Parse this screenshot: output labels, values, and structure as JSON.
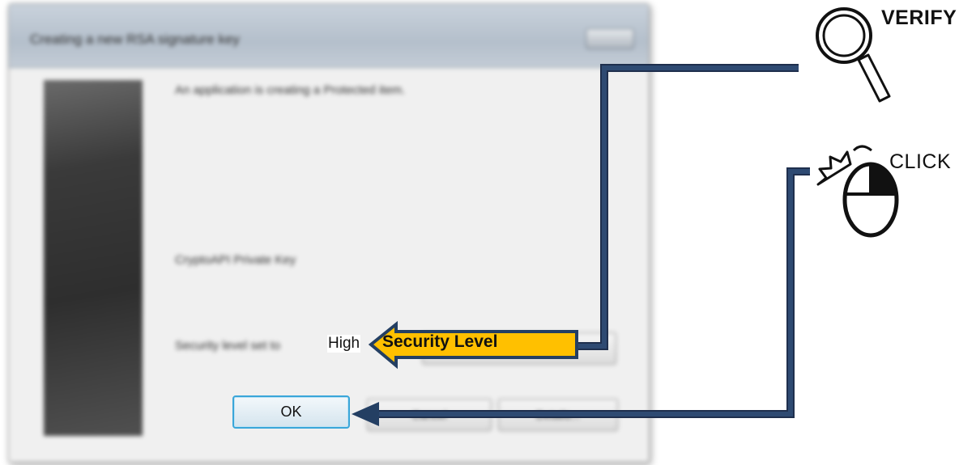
{
  "dialog": {
    "title": "Creating a new RSA signature key",
    "message": "An application is creating a Protected item.",
    "key_name": "CryptoAPI Private Key",
    "security_level_label": "Security level set to",
    "security_level_value": "High",
    "set_security_level_button": "Set Security Level...",
    "ok_button": "OK",
    "cancel_button": "Cancel",
    "details_button": "Details..."
  },
  "annotations": {
    "verify_label": "VERIFY",
    "click_label": "CLICK",
    "callout_label": "Security Level"
  },
  "icons": {
    "verify": "magnifier-icon",
    "click": "mouse-click-icon"
  },
  "colors": {
    "connector": "#243f63",
    "callout_fill": "#ffc000",
    "ok_border": "#3aa6d9"
  }
}
